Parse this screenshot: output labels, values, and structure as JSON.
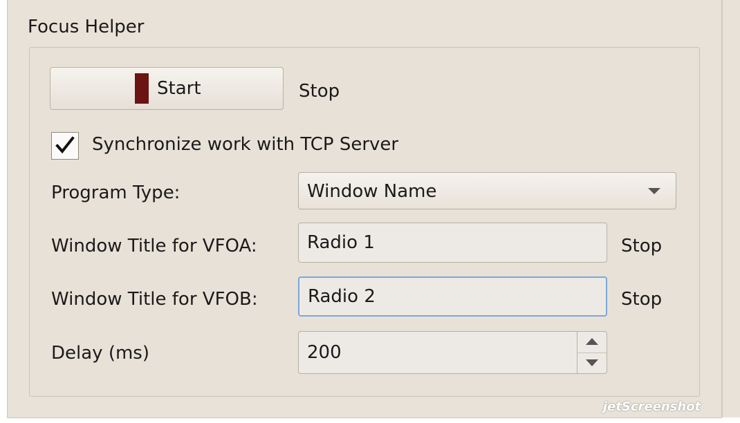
{
  "group": {
    "title": "Focus Helper"
  },
  "start_button": {
    "label": "Start",
    "indicator_color": "#6b1414"
  },
  "start_status": "Stop",
  "sync_checkbox": {
    "label": "Synchronize work with TCP Server",
    "checked": true
  },
  "program_type": {
    "label": "Program Type:",
    "value": "Window Name"
  },
  "vfoa": {
    "label": "Window Title for VFOA:",
    "value": "Radio 1",
    "status": "Stop"
  },
  "vfob": {
    "label": "Window Title for VFOB:",
    "value": "Radio 2",
    "status": "Stop"
  },
  "delay": {
    "label": "Delay (ms)",
    "value": "200"
  },
  "watermark": {
    "text": "jetScreenshot"
  },
  "colors": {
    "focus_border": "#7aa7d8",
    "background": "#e9e2d8"
  }
}
